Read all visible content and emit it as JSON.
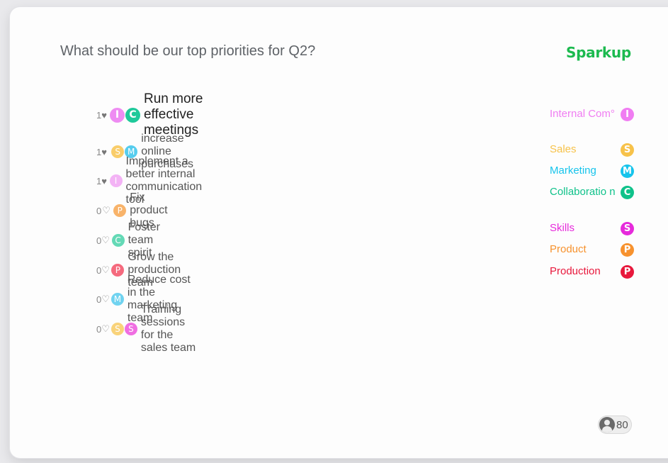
{
  "question": "What should be our top priorities for Q2?",
  "brand": "Sparkup",
  "ideas": [
    {
      "votes": "1",
      "heart": "♥",
      "text": "Run more effective meetings",
      "tags": [
        {
          "letter": "I",
          "color": "#ee8cf2"
        },
        {
          "letter": "C",
          "color": "#1ec99a"
        }
      ]
    },
    {
      "votes": "1",
      "heart": "♥",
      "text": "increase online purchases",
      "tags": [
        {
          "letter": "S",
          "color": "#f9cd6a"
        },
        {
          "letter": "M",
          "color": "#56cdee"
        }
      ]
    },
    {
      "votes": "1",
      "heart": "♥",
      "text": "Implement a better internal communication tool",
      "tags": [
        {
          "letter": "I",
          "color": "#f3b3f5"
        }
      ]
    },
    {
      "votes": "0",
      "heart": "♡",
      "text": "Fix product bugs",
      "tags": [
        {
          "letter": "P",
          "color": "#f8b36a"
        }
      ]
    },
    {
      "votes": "0",
      "heart": "♡",
      "text": "Foster team spirit",
      "tags": [
        {
          "letter": "C",
          "color": "#64d9b6"
        }
      ]
    },
    {
      "votes": "0",
      "heart": "♡",
      "text": "Grow the production team",
      "tags": [
        {
          "letter": "P",
          "color": "#f56a7e"
        }
      ]
    },
    {
      "votes": "0",
      "heart": "♡",
      "text": "Reduce cost in the marketing team",
      "tags": [
        {
          "letter": "M",
          "color": "#70d3f0"
        }
      ]
    },
    {
      "votes": "0",
      "heart": "♡",
      "text": "Training sessions for the sales team",
      "tags": [
        {
          "letter": "S",
          "color": "#f9d37a"
        },
        {
          "letter": "S",
          "color": "#f06ee2"
        }
      ]
    }
  ],
  "legend": [
    {
      "label": "Internal Com°",
      "letter": "I",
      "color": "#f07df2"
    },
    {
      "label": "Sales",
      "letter": "S",
      "color": "#f7c24a"
    },
    {
      "label": "Marketing",
      "letter": "M",
      "color": "#16c4ec"
    },
    {
      "label": "Collaboratio n",
      "letter": "C",
      "color": "#0fc28a"
    },
    {
      "label": "Skills",
      "letter": "S",
      "color": "#e62adb"
    },
    {
      "label": "Product",
      "letter": "P",
      "color": "#f7922e"
    },
    {
      "label": "Production",
      "letter": "P",
      "color": "#e8183c"
    }
  ],
  "participants": {
    "count": "80"
  }
}
